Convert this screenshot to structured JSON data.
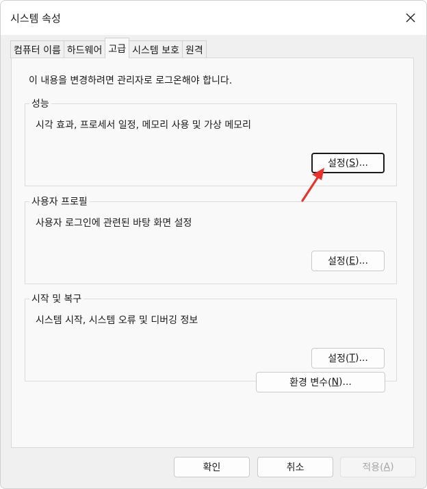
{
  "window": {
    "title": "시스템 속성",
    "close_glyph": "✕"
  },
  "tabs": [
    {
      "label": "컴퓨터 이름",
      "active": false
    },
    {
      "label": "하드웨어",
      "active": false
    },
    {
      "label": "고급",
      "active": true
    },
    {
      "label": "시스템 보호",
      "active": false
    },
    {
      "label": "원격",
      "active": false
    }
  ],
  "notice": "이 내용을 변경하려면 관리자로 로그온해야 합니다.",
  "groups": {
    "performance": {
      "label": "성능",
      "description": "시각 효과, 프로세서 일정, 메모리 사용 및 가상 메모리",
      "button": {
        "text": "설정(",
        "mnemonic": "S",
        "suffix": ")..."
      }
    },
    "user_profiles": {
      "label": "사용자 프로필",
      "description": "사용자 로그인에 관련된 바탕 화면 설정",
      "button": {
        "text": "설정(",
        "mnemonic": "E",
        "suffix": ")..."
      }
    },
    "startup_recovery": {
      "label": "시작 및 복구",
      "description": "시스템 시작, 시스템 오류 및 디버깅 정보",
      "button": {
        "text": "설정(",
        "mnemonic": "T",
        "suffix": ")..."
      }
    }
  },
  "env_button": {
    "text": "환경 변수(",
    "mnemonic": "N",
    "suffix": ")..."
  },
  "footer": {
    "ok": "확인",
    "cancel": "취소",
    "apply": {
      "text": "적용(",
      "mnemonic": "A",
      "suffix": ")"
    }
  },
  "colors": {
    "annotation_arrow": "#e8322b",
    "window_bg": "#f0f0f0",
    "panel_bg": "#f9f9f9"
  }
}
